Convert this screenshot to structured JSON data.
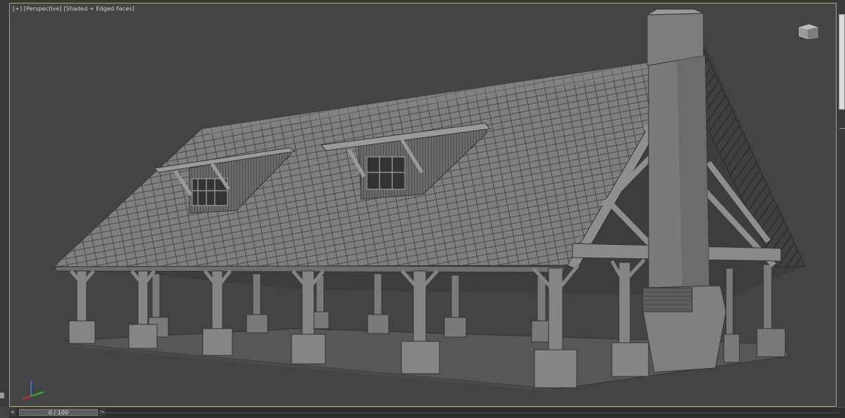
{
  "viewport": {
    "label_plus": "[+]",
    "label_view": "[Perspective]",
    "label_shading": "[Shaded + Edged Faces]"
  },
  "timeline": {
    "frame_display": "0 / 100",
    "prev_glyph": "<",
    "next_glyph": ">",
    "current_frame": 0,
    "total_frames": 100
  },
  "colors": {
    "viewport_bg": "#444444",
    "active_border": "#b8a46a",
    "model_light": "#8c8c8c",
    "model_dark": "#5a5a5a"
  },
  "icons": {
    "navcube": "view-cube-icon",
    "axis": "axis-tripod-icon"
  }
}
